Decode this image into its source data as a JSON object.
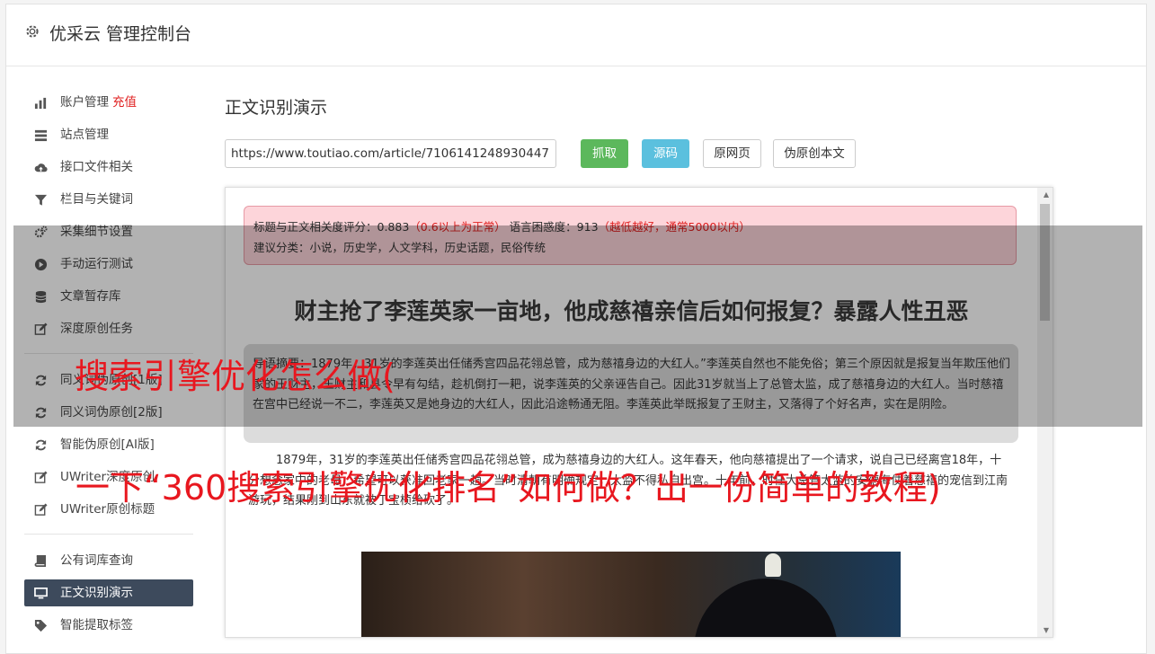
{
  "header": {
    "title": "优采云 管理控制台"
  },
  "sidebar": {
    "items": [
      {
        "label": "账户管理",
        "tag": "充值",
        "icon": "bar-chart-icon"
      },
      {
        "label": "站点管理",
        "icon": "server-icon"
      },
      {
        "label": "接口文件相关",
        "icon": "cloud-upload-icon"
      },
      {
        "label": "栏目与关键词",
        "icon": "filter-icon"
      },
      {
        "label": "采集细节设置",
        "icon": "gears-icon"
      },
      {
        "label": "手动运行测试",
        "icon": "play-circle-icon"
      },
      {
        "label": "文章暂存库",
        "icon": "database-icon"
      },
      {
        "label": "深度原创任务",
        "icon": "edit-icon"
      },
      {
        "label": "同义词伪原创[1版]",
        "icon": "refresh-icon"
      },
      {
        "label": "同义词伪原创[2版]",
        "icon": "refresh-icon"
      },
      {
        "label": "智能伪原创[AI版]",
        "icon": "refresh-icon"
      },
      {
        "label": "UWriter深度原创",
        "icon": "edit-icon"
      },
      {
        "label": "UWriter原创标题",
        "icon": "edit-icon"
      },
      {
        "label": "公有词库查询",
        "icon": "book-icon"
      },
      {
        "label": "正文识别演示",
        "icon": "monitor-icon"
      },
      {
        "label": "智能提取标签",
        "icon": "tag-icon"
      }
    ]
  },
  "main": {
    "title": "正文识别演示",
    "url_value": "https://www.toutiao.com/article/7106141248930447",
    "buttons": {
      "grab": "抓取",
      "source": "源码",
      "original": "原网页",
      "pseudo": "伪原创本文"
    }
  },
  "alert": {
    "score_label": "标题与正文相关度评分：0.883",
    "score_note": "（0.6以上为正常）",
    "confusion_label": "语言困惑度：913",
    "confusion_note": "（越低越好，通常5000以内）",
    "categories": "建议分类：小说，历史学，人文学科，历史话题，民俗传统"
  },
  "article": {
    "title": "财主抢了李莲英家一亩地，他成慈禧亲信后如何报复？暴露人性丑恶",
    "summary": "导语摘要：1879年，31岁的李莲英出任储秀宫四品花翎总管，成为慈禧身边的大红人。”李莲英自然也不能免俗；第三个原因就是报复当年欺压他们家的王财主，王财主和县令早有勾结，趁机倒打一耙，说李莲英的父亲诬告自己。因此31岁就当上了总管太监，成了慈禧身边的大红人。当时慈禧在宫中已经说一不二，李莲英又是她身边的大红人，因此沿途畅通无阻。李莲英此举既报复了王财主，又落得了个好名声，实在是阴险。",
    "paragraph": "1879年，31岁的李莲英出任储秀宫四品花翎总管，成为慈禧身边的大红人。这年春天，他向慈禧提出了一个请求，说自己已经离宫18年，十分想念家中的老母，希望可以获准回老家一趟。当时清朝有明确规定，太监不得私自出宫。十年前，时任大总管太监的安德海仗着慈禧的宠信到江南游玩，结果刚到山东就被丁宝桢给砍了。"
  },
  "overlay": {
    "line1": "搜索引擎优化怎么做(",
    "line2": "一下“360搜索引擎优化排名”如何做？出一份简单的教程)"
  },
  "colors": {
    "accent": "#e02020",
    "active_nav": "#3d4a5c",
    "grab_button": "#5cb85c",
    "source_button": "#5bc0de"
  }
}
